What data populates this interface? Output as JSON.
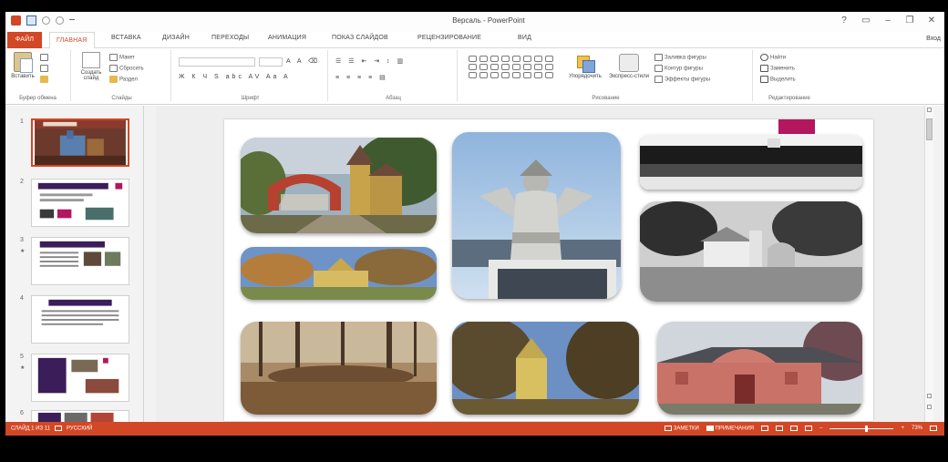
{
  "window": {
    "title": "Версаль - PowerPoint"
  },
  "tabs": [
    "ФАЙЛ",
    "ГЛАВНАЯ",
    "ВСТАВКА",
    "ДИЗАЙН",
    "ПЕРЕХОДЫ",
    "АНИМАЦИЯ",
    "ПОКАЗ СЛАЙДОВ",
    "РЕЦЕНЗИРОВАНИЕ",
    "ВИД"
  ],
  "active_tab": "ГЛАВНАЯ",
  "user_name": "Вход",
  "ribbon": {
    "clipboard": {
      "paste": "Вставить",
      "label": "Буфер обмена"
    },
    "slides": {
      "new_slide": "Создать слайд",
      "layout": "Макет",
      "reset": "Сбросить",
      "section": "Раздел",
      "label": "Слайды"
    },
    "font": {
      "label": "Шрифт"
    },
    "paragraph": {
      "label": "Абзац"
    },
    "drawing": {
      "arrange": "Упорядочить",
      "quick_styles": "Экспресс-стили",
      "fill": "Заливка фигуры",
      "outline": "Контур фигуры",
      "effects": "Эффекты фигуры",
      "label": "Рисование"
    },
    "editing": {
      "find": "Найти",
      "replace": "Заменить",
      "select": "Выделить",
      "label": "Редактирование"
    }
  },
  "slides_panel": {
    "numbers": [
      "1",
      "2",
      "3",
      "4",
      "5",
      "6"
    ],
    "selected": 1
  },
  "status": {
    "slide_info": "СЛАЙД 1 ИЗ 11",
    "language": "РУССКИЙ",
    "notes": "ЗАМЕТКИ",
    "comments": "ПРИМЕЧАНИЯ",
    "zoom": "73%",
    "zoom_fraction": 0.55
  },
  "colors": {
    "accent": "#d24726",
    "slide_accent": "#b3175e"
  },
  "photos": [
    {
      "name": "red-gate-yellow-tower"
    },
    {
      "name": "angel-statue-sky"
    },
    {
      "name": "bw-lake-panorama"
    },
    {
      "name": "yellow-building-autumn"
    },
    {
      "name": "bw-manor-house"
    },
    {
      "name": "forest-ruins"
    },
    {
      "name": "yellow-church-trees"
    },
    {
      "name": "pink-brick-gate-building"
    }
  ]
}
